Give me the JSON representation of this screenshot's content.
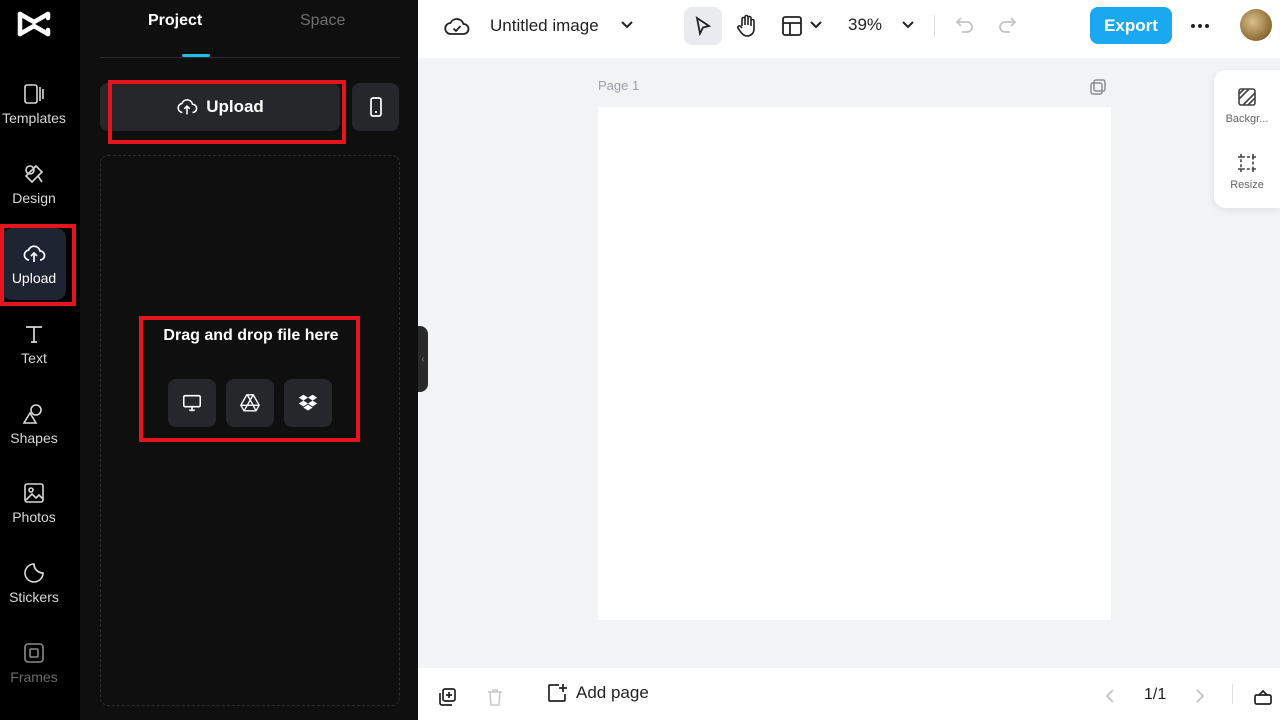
{
  "rail": {
    "items": [
      {
        "label": "Templates",
        "icon": "templates-icon"
      },
      {
        "label": "Design",
        "icon": "design-icon"
      },
      {
        "label": "Upload",
        "icon": "upload-cloud-icon",
        "active": true
      },
      {
        "label": "Text",
        "icon": "text-icon"
      },
      {
        "label": "Shapes",
        "icon": "shapes-icon"
      },
      {
        "label": "Photos",
        "icon": "photos-icon"
      },
      {
        "label": "Stickers",
        "icon": "stickers-icon"
      },
      {
        "label": "Frames",
        "icon": "frames-icon"
      }
    ]
  },
  "panel": {
    "tabs": [
      {
        "label": "Project"
      },
      {
        "label": "Space"
      }
    ],
    "upload_label": "Upload",
    "drop_text": "Drag and drop file here",
    "sources": [
      "computer-icon",
      "google-drive-icon",
      "dropbox-icon"
    ]
  },
  "topbar": {
    "doc_title": "Untitled image",
    "zoom": "39%",
    "export_label": "Export"
  },
  "canvas": {
    "page_label": "Page 1",
    "side_tools": [
      {
        "label": "Backgr..."
      },
      {
        "label": "Resize"
      }
    ]
  },
  "bottombar": {
    "add_page_label": "Add page",
    "page_count": "1/1"
  },
  "colors": {
    "accent": "#1aa8f0",
    "highlight": "#e5141d",
    "tab_underline": "#1fbbe9"
  }
}
